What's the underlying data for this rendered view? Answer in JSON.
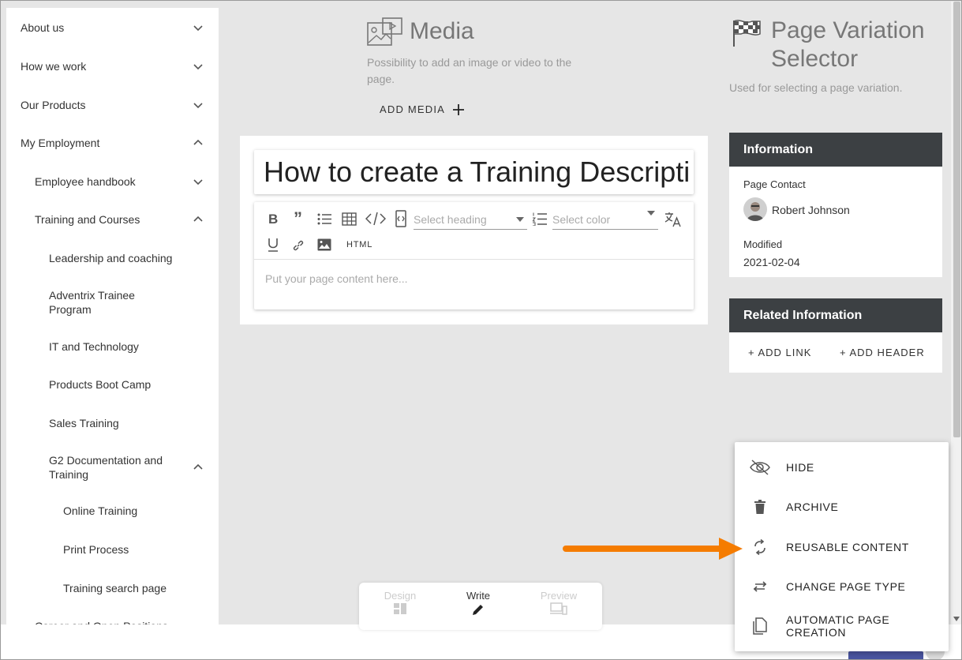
{
  "sidebar": {
    "items": [
      {
        "label": "About us",
        "expanded": false
      },
      {
        "label": "How we work",
        "expanded": false
      },
      {
        "label": "Our Products",
        "expanded": false
      },
      {
        "label": "My Employment",
        "expanded": true
      },
      {
        "label": "Employee handbook",
        "expanded": false
      },
      {
        "label": "Training and Courses",
        "expanded": true
      },
      {
        "label": "Leadership and coaching"
      },
      {
        "label": "Adventrix Trainee Program"
      },
      {
        "label": "IT and Technology"
      },
      {
        "label": "Products Boot Camp"
      },
      {
        "label": "Sales Training"
      },
      {
        "label": "G2 Documentation and Training",
        "expanded": true
      },
      {
        "label": "Online Training"
      },
      {
        "label": "Print Process"
      },
      {
        "label": "Training search page"
      },
      {
        "label": "Career and Open Positions"
      }
    ]
  },
  "media": {
    "title": "Media",
    "description": "Possibility to add an image or video to the page.",
    "add_label": "ADD MEDIA"
  },
  "editor": {
    "page_title": "How to create a Training Descripti",
    "heading_placeholder": "Select heading",
    "color_placeholder": "Select color",
    "html_label": "HTML",
    "content_placeholder": "Put your page content here..."
  },
  "variation": {
    "title": "Page Variation Selector",
    "description": "Used for selecting a page variation."
  },
  "information": {
    "header": "Information",
    "contact_label": "Page Contact",
    "contact_name": "Robert Johnson",
    "modified_label": "Modified",
    "modified_value": "2021-02-04"
  },
  "related": {
    "header": "Related Information",
    "add_link": "ADD LINK",
    "add_header": "ADD HEADER"
  },
  "menu": {
    "items": [
      {
        "label": "HIDE",
        "icon": "eye-off-icon"
      },
      {
        "label": "ARCHIVE",
        "icon": "trash-icon"
      },
      {
        "label": "REUSABLE CONTENT",
        "icon": "sync-icon"
      },
      {
        "label": "CHANGE PAGE TYPE",
        "icon": "swap-icon"
      },
      {
        "label": "AUTOMATIC PAGE CREATION",
        "icon": "copy-icon"
      }
    ]
  },
  "modes": {
    "design": "Design",
    "write": "Write",
    "preview": "Preview",
    "active": "Write"
  },
  "colors": {
    "panel_header": "#3c4043",
    "arrow": "#f57c00",
    "page_bg": "#e6e6e6"
  }
}
